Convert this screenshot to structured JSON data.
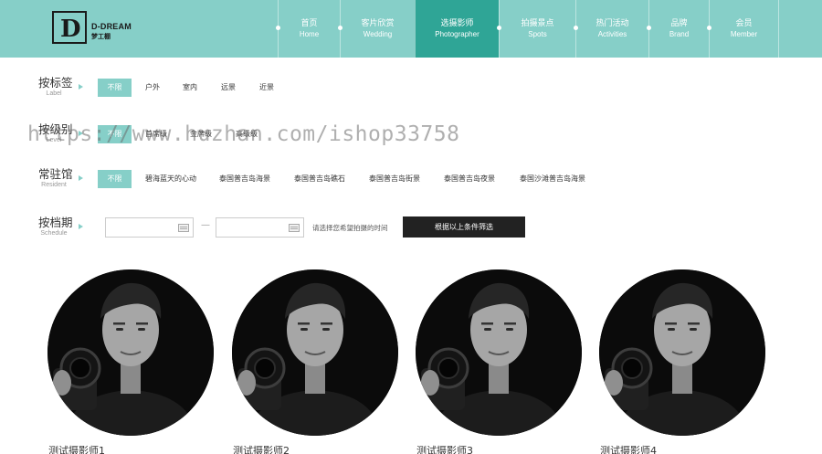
{
  "header": {
    "logo": {
      "letter": "D",
      "name": "D-DREAM",
      "sub": "梦工棚"
    },
    "nav": [
      {
        "cn": "首页",
        "en": "Home",
        "active": false
      },
      {
        "cn": "客片欣赏",
        "en": "Wedding",
        "active": false
      },
      {
        "cn": "选摄影师",
        "en": "Photographer",
        "active": true
      },
      {
        "cn": "拍摄景点",
        "en": "Spots",
        "active": false
      },
      {
        "cn": "热门活动",
        "en": "Activities",
        "active": false
      },
      {
        "cn": "品牌",
        "en": "Brand",
        "active": false
      },
      {
        "cn": "会员",
        "en": "Member",
        "active": false
      }
    ]
  },
  "filters": {
    "label": {
      "cn": "按标签",
      "en": "Label",
      "options": [
        "不限",
        "户外",
        "室内",
        "远景",
        "近景"
      ],
      "selected": 0
    },
    "level": {
      "cn": "按级别",
      "en": "Level",
      "options": [
        "不限",
        "首席级",
        "金牌级",
        "高级级"
      ],
      "selected": 0
    },
    "resident": {
      "cn": "常驻馆",
      "en": "Resident",
      "options": [
        "不限",
        "碧海蓝天的心动",
        "泰国普吉岛海景",
        "泰国普吉岛礁石",
        "泰国普吉岛街景",
        "泰国普吉岛夜景",
        "泰国沙滩普吉岛海景"
      ],
      "selected": 0
    },
    "schedule": {
      "cn": "按档期",
      "en": "Schedule",
      "start": "",
      "end": "",
      "dash": "—",
      "hint": "请选择您希望拍摄的时间",
      "button": "根据以上条件筛选"
    }
  },
  "watermark": "https://www.huzhan.com/ishop33758",
  "photographers": [
    {
      "name": "测试摄影师1"
    },
    {
      "name": "测试摄影师2"
    },
    {
      "name": "测试摄影师3"
    },
    {
      "name": "测试摄影师4"
    }
  ],
  "colors": {
    "brand": "#86cfc8",
    "nav_active": "#2fa596",
    "button": "#222222"
  }
}
